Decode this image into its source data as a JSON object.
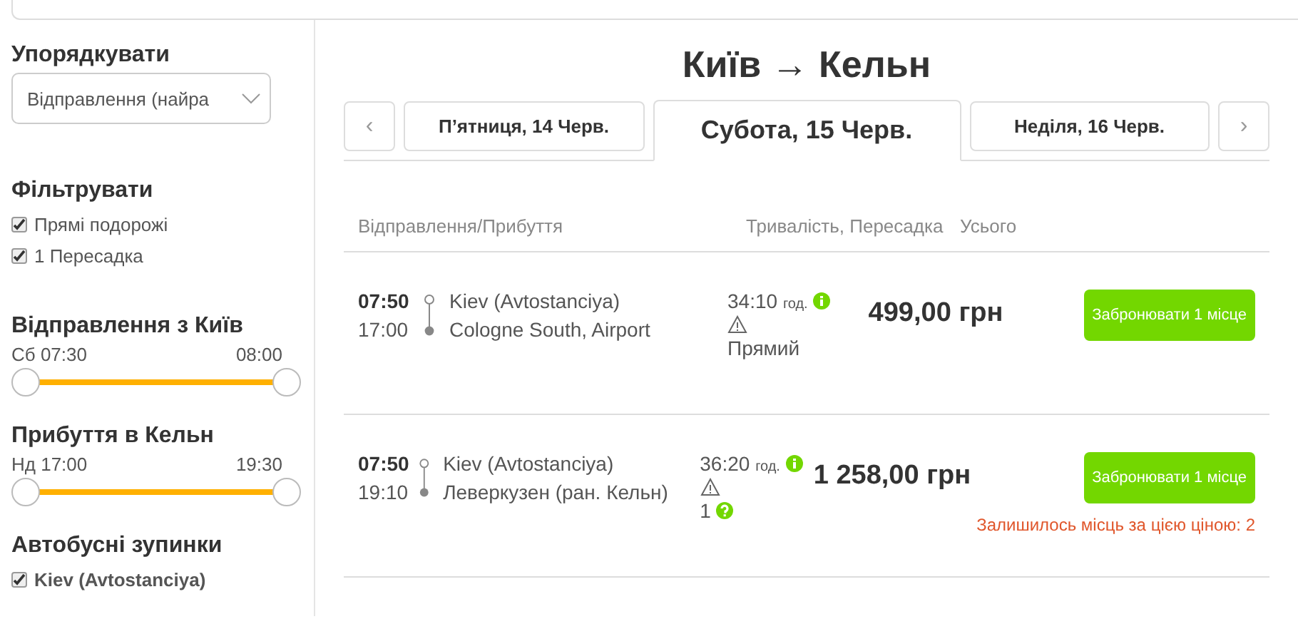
{
  "sidebar": {
    "sort": {
      "title": "Упорядкувати",
      "value": "Відправлення (найра"
    },
    "filter": {
      "title": "Фільтрувати",
      "options": [
        {
          "label": "Прямі подорожі",
          "checked": true
        },
        {
          "label": "1 Пересадка",
          "checked": true
        }
      ]
    },
    "ranges": [
      {
        "title": "Відправлення з Київ",
        "from": "Сб 07:30",
        "to": "08:00",
        "thumbs": [
          {
            "level": 0
          },
          {
            "level": 1
          }
        ]
      },
      {
        "title": "Прибуття в Кельн",
        "from": "Нд 17:00",
        "to": "19:30",
        "thumbs": [
          {
            "level": 0
          },
          {
            "level": 1
          }
        ]
      }
    ],
    "stops": {
      "title": "Автобусні зупинки",
      "options": [
        {
          "label": "Kiev (Avtostanciya)",
          "checked": true
        }
      ]
    }
  },
  "main": {
    "title": "Київ → Кельн",
    "prev": "‹",
    "next": "›",
    "tabs": [
      {
        "label": "П’ятниця, 14 Черв.",
        "selected": false
      },
      {
        "label": "Субота, 15 Черв.",
        "selected": true
      },
      {
        "label": "Неділя, 16 Черв.",
        "selected": false
      }
    ],
    "columns": [
      "Відправлення/Прибуття",
      "Тривалість, Пересадка",
      "Усього"
    ],
    "rows": [
      {
        "dep": "07:50",
        "arr": "17:00",
        "from": "Kiev (Avtostanciya)",
        "to": "Cologne South, Airport",
        "duration": "34:10",
        "unit": "год.",
        "transfers": "Прямий",
        "help": false,
        "price": "499,00 грн",
        "button": "Забронювати 1 місце"
      },
      {
        "dep": "07:50",
        "arr": "19:10",
        "from": "Kiev (Avtostanciya)",
        "to": "Леверкузен (ран. Кельн)",
        "duration": "36:20",
        "unit": "год.",
        "transfers": "1",
        "help": true,
        "price": "1 258,00 грн",
        "button": "Забронювати 1 місце",
        "note": "Залишилось місць за цією ціною: 2"
      }
    ]
  }
}
